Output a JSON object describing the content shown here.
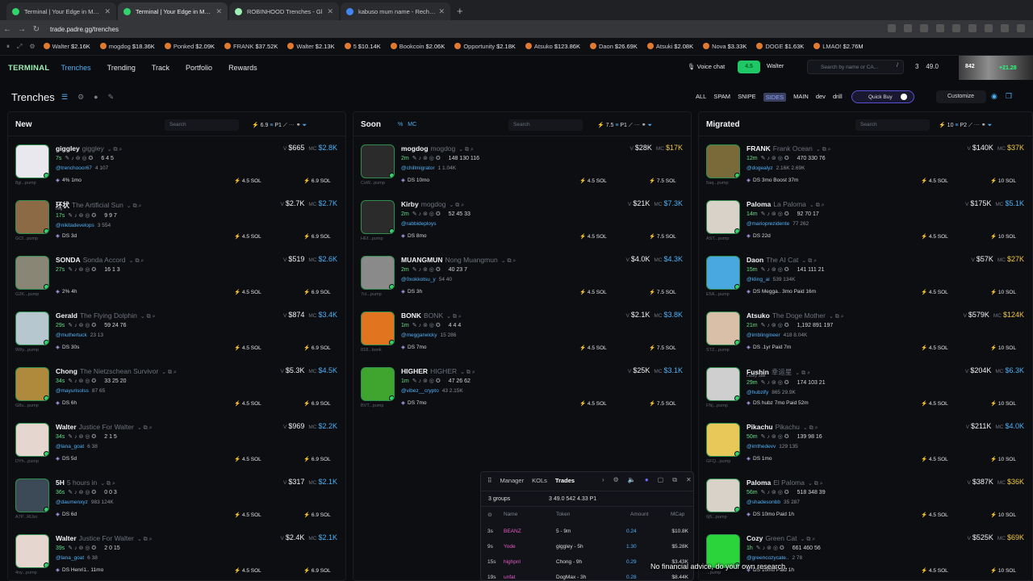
{
  "browser": {
    "tabs": [
      {
        "title": "Terminal | Your Edge in Memec",
        "color": "#2fd46a"
      },
      {
        "title": "Terminal | Your Edge in Memec",
        "color": "#2fd46a",
        "active": true
      },
      {
        "title": "ROBINHOOD Trenches - Gl",
        "color": "#9ef0b4"
      },
      {
        "title": "kabuso mum name - Recherche",
        "color": "#4285f4"
      }
    ],
    "url": "trade.padre.gg/trenches"
  },
  "ticker": [
    {
      "name": "Walter",
      "value": "$2.16K"
    },
    {
      "name": "mogdog",
      "value": "$18.36K"
    },
    {
      "name": "Ponked",
      "value": "$2.09K"
    },
    {
      "name": "FRANK",
      "value": "$37.52K"
    },
    {
      "name": "Walter",
      "value": "$2.13K"
    },
    {
      "name": "5",
      "value": "$10.14K"
    },
    {
      "name": "Bookcoin",
      "value": "$2.06K"
    },
    {
      "name": "Opportunity",
      "value": "$2.18K"
    },
    {
      "name": "Atsuko",
      "value": "$123.86K"
    },
    {
      "name": "Daon",
      "value": "$26.69K"
    },
    {
      "name": "Atsuki",
      "value": "$2.08K"
    },
    {
      "name": "Nova",
      "value": "$3.33K"
    },
    {
      "name": "DOGE",
      "value": "$1.63K"
    },
    {
      "name": "LMAO!",
      "value": "$2.76M"
    }
  ],
  "header": {
    "logo": "TERMINAL",
    "nav": [
      "Trenches",
      "Trending",
      "Track",
      "Portfolio",
      "Rewards"
    ],
    "voice": "Voice chat",
    "wallet": "4.5",
    "user": "Walter",
    "search_placeholder": "Search by name or CA...",
    "search_kbd": "/",
    "stat1": "3",
    "stat2": "49.0",
    "stream_lv": "842",
    "stream_gain": "+21.28"
  },
  "page": {
    "title": "Trenches",
    "filters": [
      "ALL",
      "SPAM",
      "SNIPE",
      "SIDES",
      "MAIN",
      "dev",
      "drill"
    ],
    "quick_buy": "Quick Buy",
    "customize": "Customize"
  },
  "columns": [
    {
      "title": "New",
      "search": "Search",
      "amount": "6.9",
      "preset": "P1",
      "rows": [
        {
          "name": "giggley",
          "full": "giggley",
          "age": "7s",
          "stats": "6  4  5",
          "handle": "@trenchooor67",
          "social": "4  107",
          "extra": "4%  1mo",
          "vol": "$665",
          "mc": "$2.8K",
          "sol1": "4.5 SOL",
          "sol2": "6.9 SOL",
          "ca": "8gi...pump",
          "img": "#e8e8ee"
        },
        {
          "name": "环状",
          "full": "The Artificial Sun",
          "sub": "ring",
          "age": "17s",
          "stats": "9  9  7",
          "handle": "@nikitadevelops",
          "social": "3  554",
          "extra": "DS  3d",
          "vol": "$2.7K",
          "mc": "$2.7K",
          "sol1": "4.5 SOL",
          "sol2": "6.9 SOL",
          "ca": "GCf...pump",
          "img": "#8c6a45"
        },
        {
          "name": "SONDA",
          "full": "Sonda Accord",
          "age": "27s",
          "stats": "16  1  3",
          "handle": "",
          "social": "",
          "extra": "2%  4h",
          "vol": "$519",
          "mc": "$2.6K",
          "sol1": "4.5 SOL",
          "sol2": "6.9 SOL",
          "ca": "G2K...pump",
          "img": "#8a8676"
        },
        {
          "name": "Gerald",
          "full": "The Flying Dolphin",
          "age": "29s",
          "stats": "59  24  76",
          "handle": "@muthertuck",
          "social": "23  13",
          "extra": "DS  30s",
          "vol": "$874",
          "mc": "$3.4K",
          "sol1": "4.5 SOL",
          "sol2": "6.9 SOL",
          "ca": "9Wy...pump",
          "img": "#b7c7cf"
        },
        {
          "name": "Chong",
          "full": "The Nietzschean Survivor",
          "age": "34s",
          "stats": "33  25  20",
          "handle": "@mayurisolss",
          "social": "87  65",
          "extra": "DS  6h",
          "vol": "$5.3K",
          "mc": "$4.5K",
          "sol1": "4.5 SOL",
          "sol2": "6.9 SOL",
          "ca": "G8u...pump",
          "img": "#b08a3c"
        },
        {
          "name": "Walter",
          "full": "Justice For Walter",
          "age": "34s",
          "stats": "2  1  5",
          "handle": "@lana_goat",
          "social": "6  38",
          "extra": "DS  5d",
          "vol": "$969",
          "mc": "$2.2K",
          "sol1": "4.5 SOL",
          "sol2": "6.9 SOL",
          "ca": "DYh...pump",
          "img": "#e6d6d0"
        },
        {
          "name": "5H",
          "full": "5 hours in",
          "age": "36s",
          "stats": "0  0  3",
          "handle": "@daumenxyz",
          "social": "983  124K",
          "extra": "DS  6d",
          "vol": "$317",
          "mc": "$2.1K",
          "sol1": "4.5 SOL",
          "sol2": "6.9 SOL",
          "ca": "A7P...RLbo",
          "img": "#3c4a58"
        },
        {
          "name": "Walter",
          "full": "Justice For Walter",
          "age": "39s",
          "stats": "2  0  15",
          "handle": "@lana_goat",
          "social": "6  38",
          "extra": "DS  Henri1..  11mo",
          "vol": "$2.4K",
          "mc": "$2.1K",
          "sol1": "4.5 SOL",
          "sol2": "6.9 SOL",
          "ca": "4ny...pump",
          "img": "#e6d6d0"
        }
      ]
    },
    {
      "title": "Soon",
      "search": "Search",
      "amount": "7.5",
      "preset": "P1",
      "tags": [
        "%",
        "MC"
      ],
      "rows": [
        {
          "name": "mogdog",
          "full": "mogdog",
          "age": "2m",
          "stats": "148  130  116",
          "handle": "@chillmigrator",
          "social": "1  1.04K",
          "extra": "DS  10mo",
          "vol": "$28K",
          "mc": "$17K",
          "mcy": true,
          "sol1": "4.5 SOL",
          "sol2": "7.5 SOL",
          "ca": "CsW...pump",
          "img": "#2b2b2b"
        },
        {
          "name": "Kirby",
          "full": "mogdog",
          "age": "2m",
          "stats": "52  45  33",
          "handle": "@rabbideploys",
          "social": "",
          "extra": "DS  8mo",
          "vol": "$21K",
          "mc": "$7.3K",
          "sol1": "4.5 SOL",
          "sol2": "7.5 SOL",
          "ca": "HEf...pump",
          "img": "#2b2b2b"
        },
        {
          "name": "MUANGMUN",
          "full": "Nong Muangmun",
          "age": "2m",
          "stats": "40  23  7",
          "handle": "@0xokkotsu_y",
          "social": "54  40",
          "extra": "DS  3h",
          "vol": "$4.0K",
          "mc": "$4.3K",
          "sol1": "4.5 SOL",
          "sol2": "7.5 SOL",
          "ca": "7ct...pump",
          "img": "#8a8a8a"
        },
        {
          "name": "BONK",
          "full": "BONK",
          "age": "1m",
          "stats": "4  4  4",
          "handle": "@meggarwicky",
          "social": "15  286",
          "extra": "DS  7mo",
          "vol": "$2.1K",
          "mc": "$3.8K",
          "sol1": "4.5 SOL",
          "sol2": "7.5 SOL",
          "ca": "818...bonk",
          "img": "#e0741f"
        },
        {
          "name": "HIGHER",
          "full": "HIGHER",
          "age": "1m",
          "stats": "47  26  62",
          "handle": "@vibez__crypto",
          "social": "43  2.15K",
          "extra": "DS  7mo",
          "vol": "$25K",
          "mc": "$3.1K",
          "sol1": "4.5 SOL",
          "sol2": "7.5 SOL",
          "ca": "BVT...pump",
          "img": "#3fa52e"
        }
      ]
    },
    {
      "title": "Migrated",
      "search": "Search",
      "amount": "10",
      "preset": "P2",
      "rows": [
        {
          "name": "FRANK",
          "full": "Frank Ocean",
          "age": "12m",
          "stats": "470  330  76",
          "handle": "@dogealyz",
          "social": "2.16K  2.69K",
          "extra": "DS  3mo  Boost 37m",
          "vol": "$140K",
          "mc": "$37K",
          "mcy": true,
          "sol1": "4.5 SOL",
          "sol2": "10 SOL",
          "ca": "5aq...pump",
          "img": "#7a6a3a"
        },
        {
          "name": "Paloma",
          "full": "La Paloma",
          "age": "14m",
          "stats": "92  70  17",
          "handle": "@mariopr­ezidente",
          "social": "77  262",
          "extra": "DS  22d",
          "vol": "$175K",
          "mc": "$5.1K",
          "sol1": "4.5 SOL",
          "sol2": "10 SOL",
          "ca": "AST...pump",
          "img": "#d8d2c8"
        },
        {
          "name": "Daon",
          "full": "The AI Cat",
          "age": "15m",
          "stats": "141  111  21",
          "handle": "@kling_ai",
          "social": "539  134K",
          "extra": "DS  Megga..  3mo  Paid 16m",
          "vol": "$57K",
          "mc": "$27K",
          "mcy": true,
          "sol1": "4.5 SOL",
          "sol2": "10 SOL",
          "ca": "E5A...pump",
          "img": "#4aa8e0"
        },
        {
          "name": "Atsuko",
          "full": "The Doge Mother",
          "age": "21m",
          "stats": "1,192  891  197",
          "handle": "@imblingineer",
          "social": "418  8.04K",
          "extra": "DS  .1yr  Paid 7m",
          "vol": "$579K",
          "mc": "$124K",
          "mcy": true,
          "sol1": "4.5 SOL",
          "sol2": "10 SOL",
          "ca": "STZ...pump",
          "img": "#d9bfa8"
        },
        {
          "name": "Fushin",
          "full": "幸运星",
          "sub": "Lucky Star",
          "age": "29m",
          "stats": "174  103  21",
          "handle": "@hubzify",
          "social": "865  29.9K",
          "extra": "DS  hubz  7mo  Paid 52m",
          "vol": "$204K",
          "mc": "$6.3K",
          "sol1": "4.5 SOL",
          "sol2": "10 SOL",
          "ca": "FNj...pump",
          "img": "#cfcfcf"
        },
        {
          "name": "Pikachu",
          "full": "Pikachu",
          "age": "50m",
          "stats": "139  98  16",
          "handle": "@imthedevv",
          "social": "129  135",
          "extra": "DS  1mo",
          "vol": "$211K",
          "mc": "$4.0K",
          "sol1": "4.5 SOL",
          "sol2": "10 SOL",
          "ca": "GFQ...pump",
          "img": "#e9c85a"
        },
        {
          "name": "Paloma",
          "full": "El Paloma",
          "age": "56m",
          "stats": "518  348  39",
          "handle": "@shadesonbb",
          "social": "35  287",
          "extra": "DS  10mo  Paid 1h",
          "vol": "$387K",
          "mc": "$36K",
          "mcy": true,
          "sol1": "4.5 SOL",
          "sol2": "10 SOL",
          "ca": "6j5...pump",
          "img": "#d8d2c8"
        },
        {
          "name": "Cozy",
          "full": "Green Cat",
          "age": "1h",
          "stats": "661  460  56",
          "handle": "@greencozycate..",
          "social": "2  78",
          "extra": "DS  10mo  Paid 1h",
          "vol": "$525K",
          "mc": "$69K",
          "mcy": true,
          "sol1": "4.5 SOL",
          "sol2": "10 SOL",
          "ca": "...pump",
          "img": "#2bd43a"
        }
      ]
    }
  ],
  "trades": {
    "tabs": [
      "Manager",
      "KOLs",
      "Trades"
    ],
    "groups": "3 groups",
    "stats": "3   49.0   542   4.33   P1",
    "headers": [
      "Name",
      "Token",
      "Amount",
      "MCap"
    ],
    "rows": [
      {
        "t": "3s",
        "name": "BEANZ",
        "token": "5 - 9m",
        "amount": "0.24",
        "mcap": "$10.8K"
      },
      {
        "t": "9s",
        "name": "Yode",
        "token": "giggley - 5h",
        "amount": "1.30",
        "mcap": "$5.28K"
      },
      {
        "t": "15s",
        "name": "highpnl",
        "token": "Chong - 9h",
        "amount": "0.29",
        "mcap": "$3.43K"
      },
      {
        "t": "19s",
        "name": "unfat",
        "token": "DogMax - 3h",
        "amount": "0.28",
        "mcap": "$8.44K"
      }
    ]
  },
  "caption": "No financial advice, do your own research."
}
